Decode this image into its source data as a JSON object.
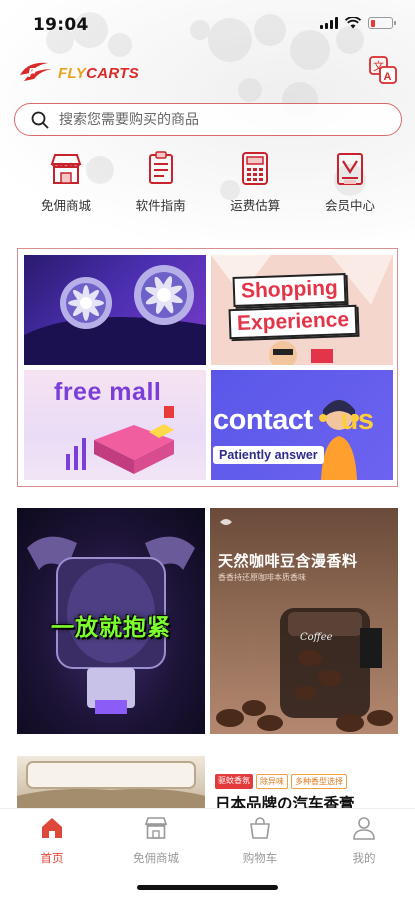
{
  "status_bar": {
    "time": "19:04"
  },
  "header": {
    "logo_text_1": "FLY",
    "logo_text_2": "CARTS",
    "translate_icon": "translate-icon"
  },
  "search": {
    "placeholder": "搜索您需要购买的商品"
  },
  "quick_nav": [
    {
      "label": "免佣商城",
      "icon": "store-icon"
    },
    {
      "label": "软件指南",
      "icon": "document-icon"
    },
    {
      "label": "运费估算",
      "icon": "calculator-icon"
    },
    {
      "label": "会员中心",
      "icon": "member-card-icon"
    }
  ],
  "banners": {
    "shopping_line1": "Shopping",
    "shopping_line2": "Experience",
    "free_mall": "free mall",
    "contact": "contact",
    "contact_us": "us",
    "contact_sub": "Patiently answer"
  },
  "promos": {
    "holder_text": "一放就抱紧",
    "coffee_title": "天然咖啡豆含漫香料",
    "coffee_sub": "香香持还原咖啡本质香味"
  },
  "article": {
    "tags": [
      "驱蚊香氛",
      "除异味",
      "多种香型选择"
    ],
    "title": "日本品牌の汽车香膏"
  },
  "tab_bar": [
    {
      "label": "首页",
      "icon": "home-icon",
      "active": true
    },
    {
      "label": "免佣商城",
      "icon": "store-icon",
      "active": false
    },
    {
      "label": "购物车",
      "icon": "cart-icon",
      "active": false
    },
    {
      "label": "我的",
      "icon": "user-icon",
      "active": false
    }
  ],
  "colors": {
    "brand_red": "#d92a2a",
    "brand_gold": "#e8a21c",
    "active_tab": "#e0473b"
  }
}
